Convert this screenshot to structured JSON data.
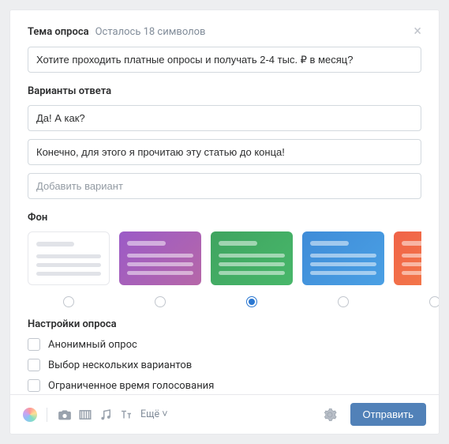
{
  "topic": {
    "label": "Тема опроса",
    "remaining": "Осталось 18 символов",
    "value": "Хотите проходить платные опросы и получать 2-4 тыс. ₽ в месяц?"
  },
  "options": {
    "label": "Варианты ответа",
    "values": [
      "Да! А как?",
      "Конечно, для этого я прочитаю эту статью до конца!"
    ],
    "add_placeholder": "Добавить вариант"
  },
  "background": {
    "label": "Фон",
    "selected_index": 2,
    "items": [
      "white",
      "purple",
      "green",
      "blue",
      "orange"
    ]
  },
  "settings": {
    "label": "Настройки опроса",
    "items": [
      {
        "label": "Анонимный опрос",
        "checked": false
      },
      {
        "label": "Выбор нескольких вариантов",
        "checked": false
      },
      {
        "label": "Ограниченное время голосования",
        "checked": false
      }
    ]
  },
  "footer": {
    "more_label": "Ещё",
    "send_label": "Отправить"
  }
}
